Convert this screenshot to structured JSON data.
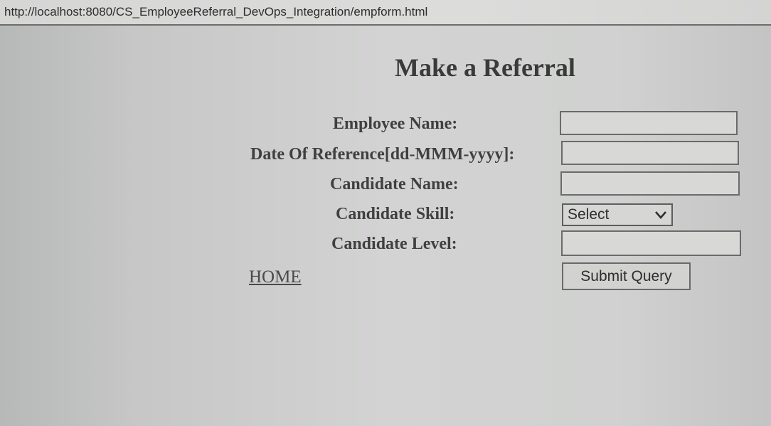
{
  "browser": {
    "url": "http://localhost:8080/CS_EmployeeReferral_DevOps_Integration/empform.html"
  },
  "page": {
    "title": "Make a Referral"
  },
  "form": {
    "employee_name": {
      "label": "Employee Name:",
      "value": ""
    },
    "date_of_reference": {
      "label": "Date Of Reference[dd-MMM-yyyy]:",
      "value": ""
    },
    "candidate_name": {
      "label": "Candidate Name:",
      "value": ""
    },
    "candidate_skill": {
      "label": "Candidate Skill:",
      "selected": "Select"
    },
    "candidate_level": {
      "label": "Candidate Level:",
      "value": ""
    },
    "submit_label": "Submit Query"
  },
  "nav": {
    "home_label": "HOME"
  }
}
